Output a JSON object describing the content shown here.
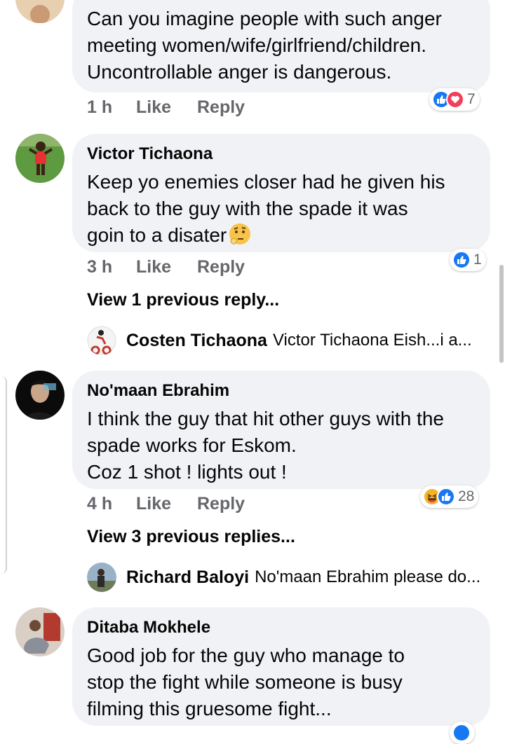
{
  "comments": [
    {
      "lines": [
        "Can you imagine people with such anger",
        "meeting women/wife/girlfriend/children.",
        "Uncontrollable anger is dangerous."
      ],
      "time": "1 h",
      "like": "Like",
      "reply": "Reply",
      "reaction_count": "7"
    },
    {
      "author": "Victor Tichaona",
      "lines": [
        "Keep yo enemies closer had he given his",
        "back to the guy with the spade it was",
        "goin to a disater"
      ],
      "time": "3 h",
      "like": "Like",
      "reply": "Reply",
      "reaction_count": "1",
      "view_replies": "View 1 previous reply...",
      "reply_preview": {
        "name": "Costen Tichaona",
        "text": "Victor Tichaona Eish...i a..."
      }
    },
    {
      "author": "No'maan Ebrahim",
      "lines": [
        "I think the guy that hit other guys with the",
        "spade works for Eskom.",
        "Coz 1 shot ! lights out !"
      ],
      "time": "4 h",
      "like": "Like",
      "reply": "Reply",
      "reaction_count": "28",
      "view_replies": "View 3 previous replies...",
      "reply_preview": {
        "name": "Richard Baloyi",
        "text": "No'maan Ebrahim please do..."
      }
    },
    {
      "author": "Ditaba Mokhele",
      "lines": [
        "Good job for the guy who manage to",
        "stop the fight while someone is busy",
        "filming this gruesome fight..."
      ]
    }
  ],
  "icons": {
    "like": "like-icon",
    "love": "love-icon",
    "haha": "haha-icon",
    "thinking": "thinking-emoji"
  },
  "colors": {
    "like_blue": "#1877f2",
    "love_red": "#f33e58",
    "haha_yellow": "#f7b125",
    "bubble": "#f0f2f5",
    "meta": "#65676b"
  }
}
